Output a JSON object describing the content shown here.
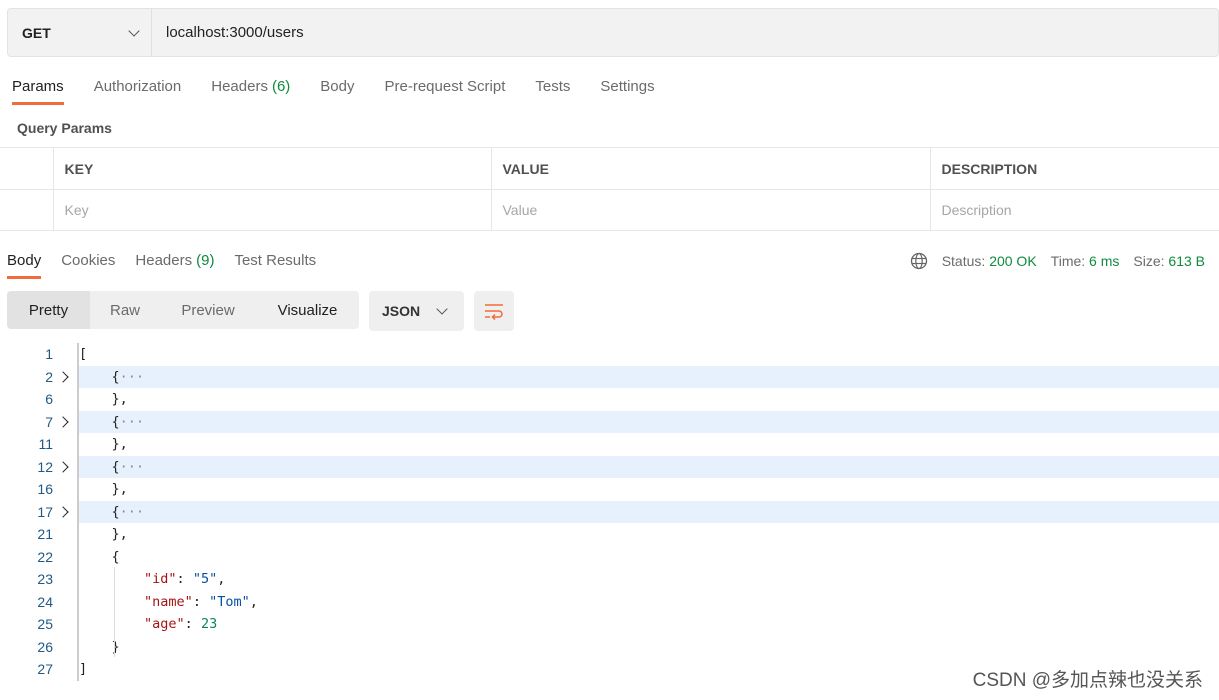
{
  "request": {
    "method": "GET",
    "url": "localhost:3000/users"
  },
  "request_tabs": [
    {
      "label": "Params",
      "active": true
    },
    {
      "label": "Authorization"
    },
    {
      "label": "Headers",
      "count": "(6)"
    },
    {
      "label": "Body"
    },
    {
      "label": "Pre-request Script"
    },
    {
      "label": "Tests"
    },
    {
      "label": "Settings"
    }
  ],
  "query_params": {
    "title": "Query Params",
    "headers": [
      "KEY",
      "VALUE",
      "DESCRIPTION"
    ],
    "placeholders": [
      "Key",
      "Value",
      "Description"
    ]
  },
  "response_tabs": [
    {
      "label": "Body",
      "active": true
    },
    {
      "label": "Cookies"
    },
    {
      "label": "Headers",
      "count": "(9)"
    },
    {
      "label": "Test Results"
    }
  ],
  "status": {
    "status_label": "Status:",
    "status_value": "200 OK",
    "time_label": "Time:",
    "time_value": "6 ms",
    "size_label": "Size:",
    "size_value": "613 B"
  },
  "view_modes": [
    "Pretty",
    "Raw",
    "Preview",
    "Visualize"
  ],
  "active_view": "Pretty",
  "format": "JSON",
  "code_lines": [
    {
      "n": "1",
      "tokens": [
        [
          "p",
          "["
        ]
      ]
    },
    {
      "n": "2",
      "fold": true,
      "tokens": [
        [
          "p",
          "    {"
        ],
        [
          "e",
          "···"
        ]
      ]
    },
    {
      "n": "6",
      "tokens": [
        [
          "p",
          "    },"
        ]
      ]
    },
    {
      "n": "7",
      "fold": true,
      "tokens": [
        [
          "p",
          "    {"
        ],
        [
          "e",
          "···"
        ]
      ]
    },
    {
      "n": "11",
      "tokens": [
        [
          "p",
          "    },"
        ]
      ]
    },
    {
      "n": "12",
      "fold": true,
      "tokens": [
        [
          "p",
          "    {"
        ],
        [
          "e",
          "···"
        ]
      ]
    },
    {
      "n": "16",
      "tokens": [
        [
          "p",
          "    },"
        ]
      ]
    },
    {
      "n": "17",
      "fold": true,
      "tokens": [
        [
          "p",
          "    {"
        ],
        [
          "e",
          "···"
        ]
      ]
    },
    {
      "n": "21",
      "tokens": [
        [
          "p",
          "    },"
        ]
      ]
    },
    {
      "n": "22",
      "tokens": [
        [
          "p",
          "    {"
        ]
      ]
    },
    {
      "n": "23",
      "tokens": [
        [
          "p",
          "        "
        ],
        [
          "k",
          "\"id\""
        ],
        [
          "p",
          ": "
        ],
        [
          "s",
          "\"5\""
        ],
        [
          "p",
          ","
        ]
      ]
    },
    {
      "n": "24",
      "tokens": [
        [
          "p",
          "        "
        ],
        [
          "k",
          "\"name\""
        ],
        [
          "p",
          ": "
        ],
        [
          "s",
          "\"Tom\""
        ],
        [
          "p",
          ","
        ]
      ]
    },
    {
      "n": "25",
      "tokens": [
        [
          "p",
          "        "
        ],
        [
          "k",
          "\"age\""
        ],
        [
          "p",
          ": "
        ],
        [
          "n",
          "23"
        ]
      ]
    },
    {
      "n": "26",
      "tokens": [
        [
          "p",
          "    }"
        ]
      ]
    },
    {
      "n": "27",
      "tokens": [
        [
          "p",
          "]"
        ]
      ]
    }
  ],
  "watermark": "CSDN @多加点辣也没关系",
  "colors": {
    "accent": "#f26b3a",
    "success": "#0f8a3e",
    "fold_highlight": "#e6f1fd"
  }
}
